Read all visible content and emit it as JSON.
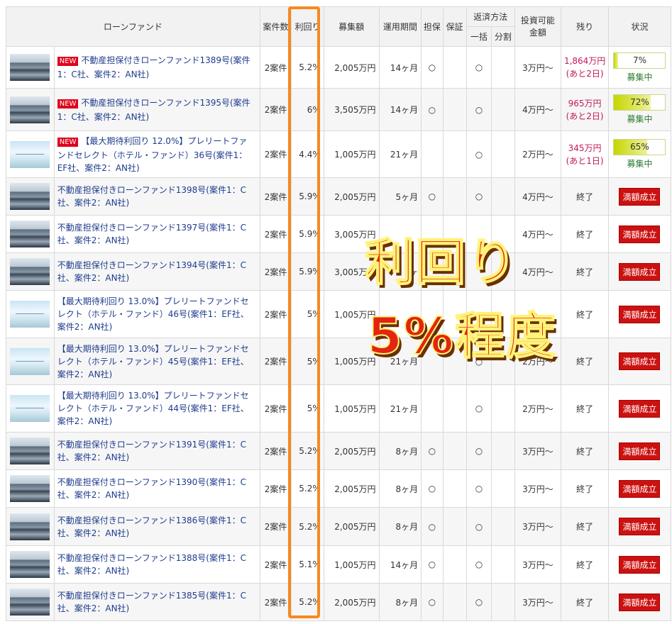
{
  "header": {
    "fund": "ローンファンド",
    "cases": "案件数",
    "yield": "利回り",
    "amount": "募集額",
    "period": "運用期間",
    "collateral": "担保",
    "guarantee": "保証",
    "repay": "返済方法",
    "repay_lump": "一括",
    "repay_split": "分割",
    "min": "投資可能金額",
    "remain": "残り",
    "status": "状況"
  },
  "rows": [
    {
      "thumb": "city",
      "is_new": true,
      "new_label": "NEW",
      "name": "不動産担保付きローンファンド1389号(案件1：C社、案件2：AN社)",
      "cases": "2案件",
      "yield": "5.2%",
      "amount": "2,005万円",
      "period": "14ヶ月",
      "collateral": "○",
      "guarantee": "",
      "lump": "○",
      "split": "",
      "min": "3万円～",
      "remain_amount": "1,864万円",
      "remain_days": "(あと2日)",
      "progress_label": "7%",
      "progress": 7,
      "status": "募集中"
    },
    {
      "thumb": "city",
      "is_new": true,
      "new_label": "NEW",
      "name": "不動産担保付きローンファンド1395号(案件1：C社、案件2：AN社)",
      "cases": "2案件",
      "yield": "6%",
      "amount": "3,505万円",
      "period": "14ヶ月",
      "collateral": "○",
      "guarantee": "",
      "lump": "○",
      "split": "",
      "min": "4万円～",
      "remain_amount": "965万円",
      "remain_days": "(あと2日)",
      "progress_label": "72%",
      "progress": 72,
      "status": "募集中"
    },
    {
      "thumb": "sky",
      "is_new": true,
      "new_label": "NEW",
      "name": "【最大期待利回り 12.0%】プレリートファンドセレクト（ホテル・ファンド）36号(案件1：EF社、案件2：AN社)",
      "cases": "2案件",
      "yield": "4.4%",
      "amount": "1,005万円",
      "period": "21ヶ月",
      "collateral": "",
      "guarantee": "",
      "lump": "○",
      "split": "",
      "min": "2万円～",
      "remain_amount": "345万円",
      "remain_days": "(あと1日)",
      "progress_label": "65%",
      "progress": 65,
      "status": "募集中"
    },
    {
      "thumb": "city",
      "is_new": false,
      "name": "不動産担保付きローンファンド1398号(案件1：C社、案件2：AN社)",
      "cases": "2案件",
      "yield": "5.9%",
      "amount": "2,005万円",
      "period": "5ヶ月",
      "collateral": "○",
      "guarantee": "",
      "lump": "○",
      "split": "",
      "min": "4万円～",
      "remain_amount": "終了",
      "status": "満額成立"
    },
    {
      "thumb": "city",
      "is_new": false,
      "name": "不動産担保付きローンファンド1397号(案件1：C社、案件2：AN社)",
      "cases": "2案件",
      "yield": "5.9%",
      "amount": "3,005万円",
      "period": "",
      "collateral": "",
      "guarantee": "",
      "lump": "",
      "split": "",
      "min": "4万円～",
      "remain_amount": "終了",
      "status": "満額成立"
    },
    {
      "thumb": "city",
      "is_new": false,
      "name": "不動産担保付きローンファンド1394号(案件1：C社、案件2：AN社)",
      "cases": "2案件",
      "yield": "5.9%",
      "amount": "3,005万円",
      "period": "5ヶ",
      "collateral": "",
      "guarantee": "",
      "lump": "",
      "split": "",
      "min": "4万円～",
      "remain_amount": "終了",
      "status": "満額成立"
    },
    {
      "thumb": "sky",
      "is_new": false,
      "name": "【最大期待利回り 13.0%】プレリートファンドセレクト（ホテル・ファンド）46号(案件1：EF社、案件2：AN社)",
      "cases": "2案件",
      "yield": "5%",
      "amount": "1,005万円",
      "period": "",
      "collateral": "",
      "guarantee": "",
      "lump": "",
      "split": "",
      "min": "",
      "remain_amount": "終了",
      "status": "満額成立"
    },
    {
      "thumb": "sky",
      "is_new": false,
      "name": "【最大期待利回り 13.0%】プレリートファンドセレクト（ホテル・ファンド）45号(案件1：EF社、案件2：AN社)",
      "cases": "2案件",
      "yield": "5%",
      "amount": "1,005万円",
      "period": "21ヶ月",
      "collateral": "",
      "guarantee": "",
      "lump": "○",
      "split": "",
      "min": "2万円～",
      "remain_amount": "終了",
      "status": "満額成立"
    },
    {
      "thumb": "sky",
      "is_new": false,
      "name": "【最大期待利回り 13.0%】プレリートファンドセレクト（ホテル・ファンド）44号(案件1：EF社、案件2：AN社)",
      "cases": "2案件",
      "yield": "5%",
      "amount": "1,005万円",
      "period": "21ヶ月",
      "collateral": "",
      "guarantee": "",
      "lump": "○",
      "split": "",
      "min": "2万円～",
      "remain_amount": "終了",
      "status": "満額成立"
    },
    {
      "thumb": "city",
      "is_new": false,
      "name": "不動産担保付きローンファンド1391号(案件1：C社、案件2：AN社)",
      "cases": "2案件",
      "yield": "5.2%",
      "amount": "2,005万円",
      "period": "8ヶ月",
      "collateral": "○",
      "guarantee": "",
      "lump": "○",
      "split": "",
      "min": "3万円～",
      "remain_amount": "終了",
      "status": "満額成立"
    },
    {
      "thumb": "city",
      "is_new": false,
      "name": "不動産担保付きローンファンド1390号(案件1：C社、案件2：AN社)",
      "cases": "2案件",
      "yield": "5.2%",
      "amount": "2,005万円",
      "period": "8ヶ月",
      "collateral": "○",
      "guarantee": "",
      "lump": "○",
      "split": "",
      "min": "3万円～",
      "remain_amount": "終了",
      "status": "満額成立"
    },
    {
      "thumb": "city",
      "is_new": false,
      "name": "不動産担保付きローンファンド1386号(案件1：C社、案件2：AN社)",
      "cases": "2案件",
      "yield": "5.2%",
      "amount": "2,005万円",
      "period": "8ヶ月",
      "collateral": "○",
      "guarantee": "",
      "lump": "○",
      "split": "",
      "min": "3万円～",
      "remain_amount": "終了",
      "status": "満額成立"
    },
    {
      "thumb": "city",
      "is_new": false,
      "name": "不動産担保付きローンファンド1388号(案件1：C社、案件2：AN社)",
      "cases": "2案件",
      "yield": "5.1%",
      "amount": "1,005万円",
      "period": "14ヶ月",
      "collateral": "○",
      "guarantee": "",
      "lump": "○",
      "split": "",
      "min": "3万円～",
      "remain_amount": "終了",
      "status": "満額成立"
    },
    {
      "thumb": "city",
      "is_new": false,
      "name": "不動産担保付きローンファンド1385号(案件1：C社、案件2：AN社)",
      "cases": "2案件",
      "yield": "5.2%",
      "amount": "2,005万円",
      "period": "8ヶ月",
      "collateral": "○",
      "guarantee": "",
      "lump": "○",
      "split": "",
      "min": "3万円～",
      "remain_amount": "終了",
      "status": "満額成立"
    }
  ],
  "overlay": {
    "line1": "利回り",
    "line2": "5%程度"
  },
  "colors": {
    "highlight": "#f7891e",
    "overlay_text": "#e32412",
    "badge": "#cc1111",
    "remain": "#c2185b",
    "recruiting": "#2e7d32"
  }
}
